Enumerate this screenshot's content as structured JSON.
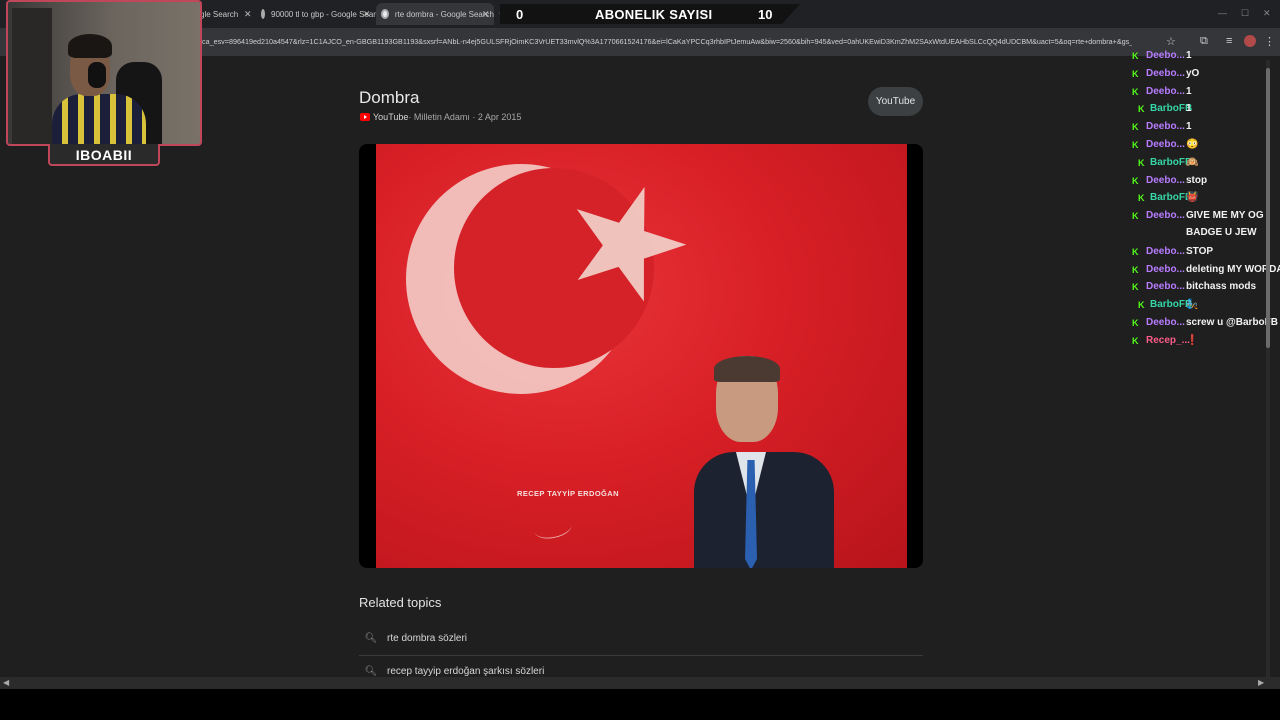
{
  "browser": {
    "tabs": [
      {
        "label": "gle Search"
      },
      {
        "label": "90000 tl to gbp - Google Search"
      },
      {
        "label": "rte dombra - Google Search"
      }
    ],
    "url": "ca_esv=896419ed210a4547&rlz=1C1AJCO_en-GBGB1193GB1193&sxsrf=ANbL-n4ej5GULSFRjOimKC3VrUET33mvlQ%3A1770661524176&ei=lCaKaYPCCq3rhbIPtJemuAw&biw=2560&bih=945&ved=0ahUKEwiD3KmZhM2SAxWtdUEAHbSLCcQQ4dUDCBM&uact=5&oq=rte+dombra+&gs_lp=Egxnd3Mtd..."
  },
  "stream_overlay": {
    "subscriber_left": "0",
    "subscriber_title": "ABONELIK SAYISI",
    "subscriber_right": "10",
    "streamer_name": "IBOABII"
  },
  "result": {
    "title": "Dombra",
    "source_name": "YouTube",
    "source_meta": " · Milletin Adamı · 2 Apr 2015",
    "platform_button": "YouTube",
    "video_caption": "RECEP TAYYİP ERDOĞAN"
  },
  "related": {
    "heading": "Related topics",
    "items": [
      {
        "label": "rte dombra sözleri"
      },
      {
        "label": "recep tayyip erdoğan şarkısı sözleri"
      }
    ]
  },
  "chat": {
    "badge": "K",
    "colors": {
      "deebo": "#b77cff",
      "barbo": "#36d6a6",
      "recep": "#ff5b8a"
    },
    "messages": [
      {
        "user": "Deebo...",
        "text": "1"
      },
      {
        "user": "Deebo...",
        "text": "yO"
      },
      {
        "user": "Deebo...",
        "text": "1"
      },
      {
        "user": "BarboFB",
        "text": "1"
      },
      {
        "user": "Deebo...",
        "text": "1"
      },
      {
        "user": "Deebo...",
        "text": "😳"
      },
      {
        "user": "BarboFB",
        "text": "🙉"
      },
      {
        "user": "Deebo...",
        "text": "stop"
      },
      {
        "user": "BarboFB",
        "text": "👹"
      },
      {
        "user": "Deebo...",
        "text": "GIVE ME MY OG",
        "cont": "BADGE U JEW"
      },
      {
        "user": "Deebo...",
        "text": "STOP"
      },
      {
        "user": "Deebo...",
        "text": "deleting MY WORDA"
      },
      {
        "user": "Deebo...",
        "text": "bitchass mods"
      },
      {
        "user": "BarboFB",
        "text": "🧞"
      },
      {
        "user": "Deebo...",
        "text": "screw u @BarboFB"
      },
      {
        "user": "Recep_...",
        "text": "❗"
      }
    ]
  }
}
